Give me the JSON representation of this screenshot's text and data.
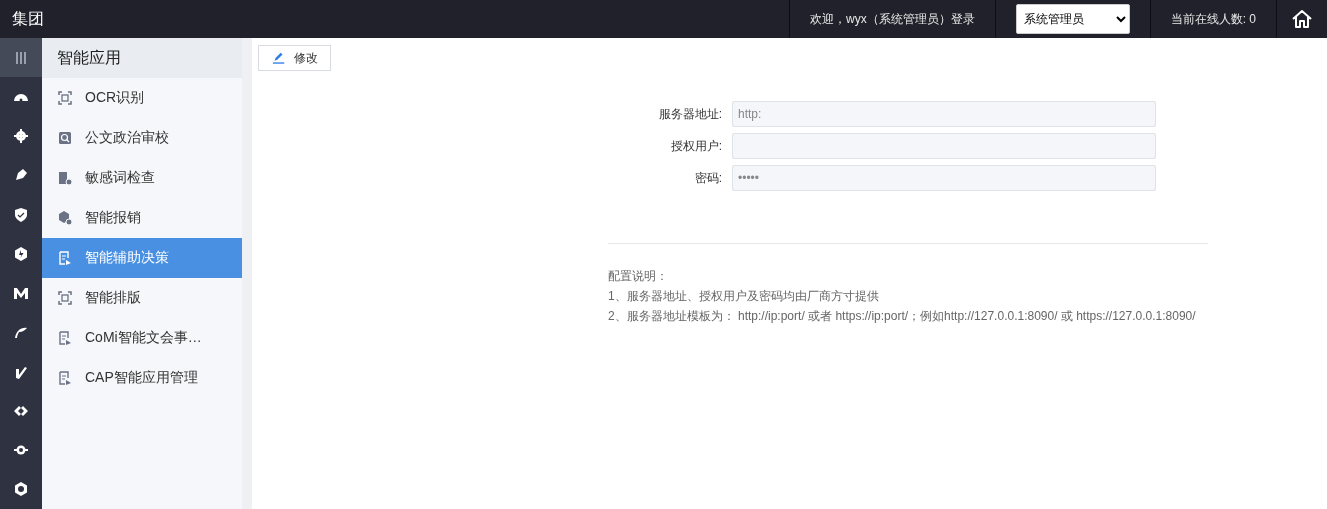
{
  "header": {
    "title": "集团",
    "welcome": "欢迎，wyx（系统管理员）登录",
    "role_select": "系统管理员",
    "online_count": "当前在线人数: 0"
  },
  "sidebar": {
    "title": "智能应用",
    "items": [
      {
        "label": "OCR识别",
        "selected": false
      },
      {
        "label": "公文政治审校",
        "selected": false
      },
      {
        "label": "敏感词检查",
        "selected": false
      },
      {
        "label": "智能报销",
        "selected": false
      },
      {
        "label": "智能辅助决策",
        "selected": true
      },
      {
        "label": "智能排版",
        "selected": false
      },
      {
        "label": "CoMi智能文会事…",
        "selected": false
      },
      {
        "label": "CAP智能应用管理",
        "selected": false
      }
    ]
  },
  "toolbar": {
    "edit_button": "修改"
  },
  "form": {
    "fields": [
      {
        "label": "服务器地址:",
        "value": "http:"
      },
      {
        "label": "授权用户:"
      },
      {
        "label": "密码:",
        "value": "•••••"
      }
    ]
  },
  "notes": [
    "配置说明：",
    "1、服务器地址、授权用户及密码均由厂商方寸提供",
    "2、服务器地址模板为： http://ip:port/ 或者 https://ip:port/；例如http://127.0.0.1:8090/ 或 https://127.0.0.1:8090/"
  ]
}
